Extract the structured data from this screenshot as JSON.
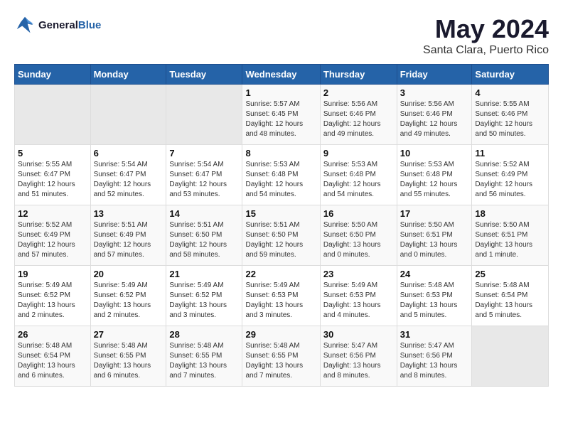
{
  "header": {
    "logo_line1": "General",
    "logo_line2": "Blue",
    "month": "May 2024",
    "location": "Santa Clara, Puerto Rico"
  },
  "weekdays": [
    "Sunday",
    "Monday",
    "Tuesday",
    "Wednesday",
    "Thursday",
    "Friday",
    "Saturday"
  ],
  "weeks": [
    [
      {
        "day": "",
        "info": ""
      },
      {
        "day": "",
        "info": ""
      },
      {
        "day": "",
        "info": ""
      },
      {
        "day": "1",
        "info": "Sunrise: 5:57 AM\nSunset: 6:45 PM\nDaylight: 12 hours\nand 48 minutes."
      },
      {
        "day": "2",
        "info": "Sunrise: 5:56 AM\nSunset: 6:46 PM\nDaylight: 12 hours\nand 49 minutes."
      },
      {
        "day": "3",
        "info": "Sunrise: 5:56 AM\nSunset: 6:46 PM\nDaylight: 12 hours\nand 49 minutes."
      },
      {
        "day": "4",
        "info": "Sunrise: 5:55 AM\nSunset: 6:46 PM\nDaylight: 12 hours\nand 50 minutes."
      }
    ],
    [
      {
        "day": "5",
        "info": "Sunrise: 5:55 AM\nSunset: 6:47 PM\nDaylight: 12 hours\nand 51 minutes."
      },
      {
        "day": "6",
        "info": "Sunrise: 5:54 AM\nSunset: 6:47 PM\nDaylight: 12 hours\nand 52 minutes."
      },
      {
        "day": "7",
        "info": "Sunrise: 5:54 AM\nSunset: 6:47 PM\nDaylight: 12 hours\nand 53 minutes."
      },
      {
        "day": "8",
        "info": "Sunrise: 5:53 AM\nSunset: 6:48 PM\nDaylight: 12 hours\nand 54 minutes."
      },
      {
        "day": "9",
        "info": "Sunrise: 5:53 AM\nSunset: 6:48 PM\nDaylight: 12 hours\nand 54 minutes."
      },
      {
        "day": "10",
        "info": "Sunrise: 5:53 AM\nSunset: 6:48 PM\nDaylight: 12 hours\nand 55 minutes."
      },
      {
        "day": "11",
        "info": "Sunrise: 5:52 AM\nSunset: 6:49 PM\nDaylight: 12 hours\nand 56 minutes."
      }
    ],
    [
      {
        "day": "12",
        "info": "Sunrise: 5:52 AM\nSunset: 6:49 PM\nDaylight: 12 hours\nand 57 minutes."
      },
      {
        "day": "13",
        "info": "Sunrise: 5:51 AM\nSunset: 6:49 PM\nDaylight: 12 hours\nand 57 minutes."
      },
      {
        "day": "14",
        "info": "Sunrise: 5:51 AM\nSunset: 6:50 PM\nDaylight: 12 hours\nand 58 minutes."
      },
      {
        "day": "15",
        "info": "Sunrise: 5:51 AM\nSunset: 6:50 PM\nDaylight: 12 hours\nand 59 minutes."
      },
      {
        "day": "16",
        "info": "Sunrise: 5:50 AM\nSunset: 6:50 PM\nDaylight: 13 hours\nand 0 minutes."
      },
      {
        "day": "17",
        "info": "Sunrise: 5:50 AM\nSunset: 6:51 PM\nDaylight: 13 hours\nand 0 minutes."
      },
      {
        "day": "18",
        "info": "Sunrise: 5:50 AM\nSunset: 6:51 PM\nDaylight: 13 hours\nand 1 minute."
      }
    ],
    [
      {
        "day": "19",
        "info": "Sunrise: 5:49 AM\nSunset: 6:52 PM\nDaylight: 13 hours\nand 2 minutes."
      },
      {
        "day": "20",
        "info": "Sunrise: 5:49 AM\nSunset: 6:52 PM\nDaylight: 13 hours\nand 2 minutes."
      },
      {
        "day": "21",
        "info": "Sunrise: 5:49 AM\nSunset: 6:52 PM\nDaylight: 13 hours\nand 3 minutes."
      },
      {
        "day": "22",
        "info": "Sunrise: 5:49 AM\nSunset: 6:53 PM\nDaylight: 13 hours\nand 3 minutes."
      },
      {
        "day": "23",
        "info": "Sunrise: 5:49 AM\nSunset: 6:53 PM\nDaylight: 13 hours\nand 4 minutes."
      },
      {
        "day": "24",
        "info": "Sunrise: 5:48 AM\nSunset: 6:53 PM\nDaylight: 13 hours\nand 5 minutes."
      },
      {
        "day": "25",
        "info": "Sunrise: 5:48 AM\nSunset: 6:54 PM\nDaylight: 13 hours\nand 5 minutes."
      }
    ],
    [
      {
        "day": "26",
        "info": "Sunrise: 5:48 AM\nSunset: 6:54 PM\nDaylight: 13 hours\nand 6 minutes."
      },
      {
        "day": "27",
        "info": "Sunrise: 5:48 AM\nSunset: 6:55 PM\nDaylight: 13 hours\nand 6 minutes."
      },
      {
        "day": "28",
        "info": "Sunrise: 5:48 AM\nSunset: 6:55 PM\nDaylight: 13 hours\nand 7 minutes."
      },
      {
        "day": "29",
        "info": "Sunrise: 5:48 AM\nSunset: 6:55 PM\nDaylight: 13 hours\nand 7 minutes."
      },
      {
        "day": "30",
        "info": "Sunrise: 5:47 AM\nSunset: 6:56 PM\nDaylight: 13 hours\nand 8 minutes."
      },
      {
        "day": "31",
        "info": "Sunrise: 5:47 AM\nSunset: 6:56 PM\nDaylight: 13 hours\nand 8 minutes."
      },
      {
        "day": "",
        "info": ""
      }
    ]
  ]
}
